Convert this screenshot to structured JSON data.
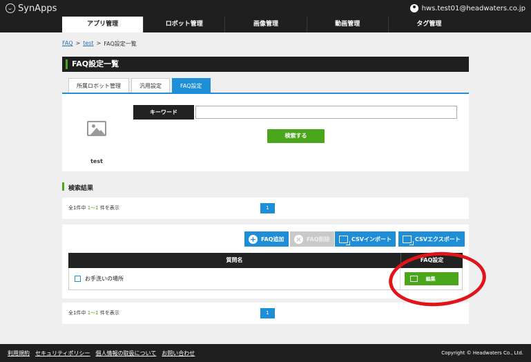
{
  "header": {
    "logo_text": "SynApps",
    "user_email": "hws.test01@headwaters.co.jp"
  },
  "nav": {
    "tabs": [
      {
        "label": "アプリ管理",
        "active": true
      },
      {
        "label": "ロボット管理",
        "active": false
      },
      {
        "label": "画像管理",
        "active": false
      },
      {
        "label": "動画管理",
        "active": false
      },
      {
        "label": "タグ管理",
        "active": false
      }
    ]
  },
  "breadcrumb": {
    "items": [
      "FAQ",
      "test",
      "FAQ設定一覧"
    ],
    "separator": ">"
  },
  "page": {
    "title": "FAQ設定一覧"
  },
  "subtabs": [
    {
      "label": "所属ロボット管理",
      "active": false
    },
    {
      "label": "汎用設定",
      "active": false
    },
    {
      "label": "FAQ設定",
      "active": true
    }
  ],
  "search": {
    "robot_name": "test",
    "keyword_label": "キーワード",
    "keyword_value": "",
    "search_button": "検索する"
  },
  "results": {
    "section_title": "検索結果",
    "count_prefix": "全1件中 ",
    "count_range": "1〜1",
    "count_suffix": " 件を表示",
    "page": "1"
  },
  "toolbar": {
    "add_faq": "FAQ追加",
    "delete_faq": "FAQ削除",
    "csv_import": "CSVインポート",
    "csv_export": "CSVエクスポート"
  },
  "table": {
    "columns": [
      "質問名",
      "FAQ設定"
    ],
    "rows": [
      {
        "question": "お手洗いの場所",
        "action": "編集"
      }
    ]
  },
  "footer": {
    "links": [
      "利用規約",
      "セキュリティポリシー",
      "個人情報の取扱について",
      "お問い合わせ"
    ],
    "copyright": "Copyright © Headwaters Co., Ltd."
  },
  "colors": {
    "accent_blue": "#1e8ed6",
    "accent_green": "#4aa71b",
    "dark_bar": "#1f1f1f",
    "highlight_red": "#e0141a"
  }
}
